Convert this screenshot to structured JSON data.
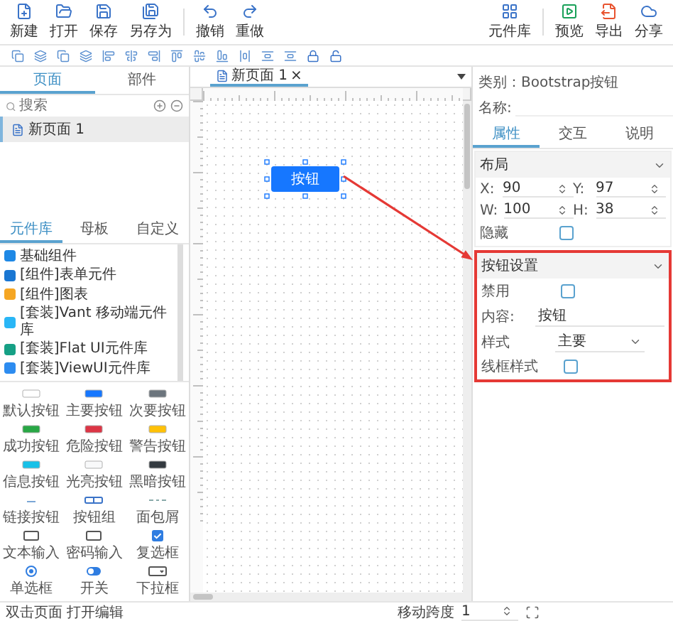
{
  "toolbar": {
    "left": [
      {
        "label": "新建",
        "kind": "new"
      },
      {
        "label": "打开",
        "kind": "open"
      },
      {
        "label": "保存",
        "kind": "save"
      },
      {
        "label": "另存为",
        "kind": "saveas"
      },
      {
        "label": "撤销",
        "kind": "undo"
      },
      {
        "label": "重做",
        "kind": "redo"
      }
    ],
    "right": [
      {
        "label": "元件库",
        "kind": "library"
      },
      {
        "label": "预览",
        "kind": "preview"
      },
      {
        "label": "导出",
        "kind": "export"
      },
      {
        "label": "分享",
        "kind": "share"
      }
    ]
  },
  "left_panel": {
    "tabs": [
      {
        "label": "页面",
        "selected": true
      },
      {
        "label": "部件",
        "selected": false
      }
    ],
    "search": {
      "placeholder": "搜索"
    },
    "pages": [
      {
        "label": "新页面 1",
        "selected": true
      }
    ],
    "library_tabs": [
      {
        "label": "元件库",
        "selected": true
      },
      {
        "label": "母板",
        "selected": false
      },
      {
        "label": "自定义",
        "selected": false
      }
    ],
    "libraries": [
      {
        "label": "基础组件",
        "color": "#1e88e5"
      },
      {
        "label": "[组件]表单元件",
        "color": "#1976d2"
      },
      {
        "label": "[组件]图表",
        "color": "#f5a623"
      },
      {
        "label": "[套装]Vant 移动端元件库",
        "color": "#29b6f6"
      },
      {
        "label": "[套装]Flat UI元件库",
        "color": "#16a085"
      },
      {
        "label": "[套装]ViewUI元件库",
        "color": "#2d8cf0"
      }
    ],
    "components": [
      {
        "label": "默认按钮",
        "kind": "button",
        "color": "#ffffff"
      },
      {
        "label": "主要按钮",
        "kind": "button",
        "color": "#1677ff"
      },
      {
        "label": "次要按钮",
        "kind": "button",
        "color": "#6c757d"
      },
      {
        "label": "成功按钮",
        "kind": "button",
        "color": "#28a745"
      },
      {
        "label": "危险按钮",
        "kind": "button",
        "color": "#dc3545"
      },
      {
        "label": "警告按钮",
        "kind": "button",
        "color": "#ffc107"
      },
      {
        "label": "信息按钮",
        "kind": "button",
        "color": "#17c1e8"
      },
      {
        "label": "光亮按钮",
        "kind": "button",
        "color": "#f8f9fa"
      },
      {
        "label": "黑暗按钮",
        "kind": "button",
        "color": "#343a40"
      },
      {
        "label": "链接按钮",
        "kind": "link"
      },
      {
        "label": "按钮组",
        "kind": "group"
      },
      {
        "label": "面包屑",
        "kind": "breadcrumb"
      },
      {
        "label": "文本输入",
        "kind": "input"
      },
      {
        "label": "密码输入",
        "kind": "input"
      },
      {
        "label": "复选框",
        "kind": "checkbox"
      },
      {
        "label": "单选框",
        "kind": "radio"
      },
      {
        "label": "开关",
        "kind": "switch"
      },
      {
        "label": "下拉框",
        "kind": "select"
      }
    ]
  },
  "canvas": {
    "tabs": [
      {
        "label": "新页面 1",
        "close": "×",
        "selected": true
      }
    ],
    "element": {
      "label": "按钮",
      "selected": true
    }
  },
  "inspector": {
    "category": "类别：Bootstrap按钮",
    "name_label": "名称:",
    "tabs": [
      {
        "label": "属性",
        "selected": true
      },
      {
        "label": "交互",
        "selected": false
      },
      {
        "label": "说明",
        "selected": false
      }
    ],
    "sections": [
      {
        "title": "布局",
        "expanded": true,
        "highlighted": false,
        "fields": [
          {
            "kind": "number",
            "label": "X:",
            "value": "90"
          },
          {
            "kind": "number",
            "label": "Y:",
            "value": "97"
          },
          {
            "kind": "number",
            "label": "W:",
            "value": "100"
          },
          {
            "kind": "number",
            "label": "H:",
            "value": "38"
          },
          {
            "kind": "checkbox",
            "label": "隐藏",
            "checked": false
          }
        ]
      },
      {
        "title": "按钮设置",
        "expanded": true,
        "highlighted": true,
        "fields": [
          {
            "kind": "checkbox",
            "label": "禁用",
            "checked": false
          },
          {
            "kind": "text",
            "label": "内容:",
            "value": "按钮"
          },
          {
            "kind": "select",
            "label": "样式",
            "value": "主要"
          },
          {
            "kind": "checkbox",
            "label": "线框样式",
            "checked": false
          }
        ]
      }
    ]
  },
  "status_bar": {
    "hint": "双击页面 打开编辑",
    "step_label": "移动跨度",
    "step_value": "1"
  }
}
